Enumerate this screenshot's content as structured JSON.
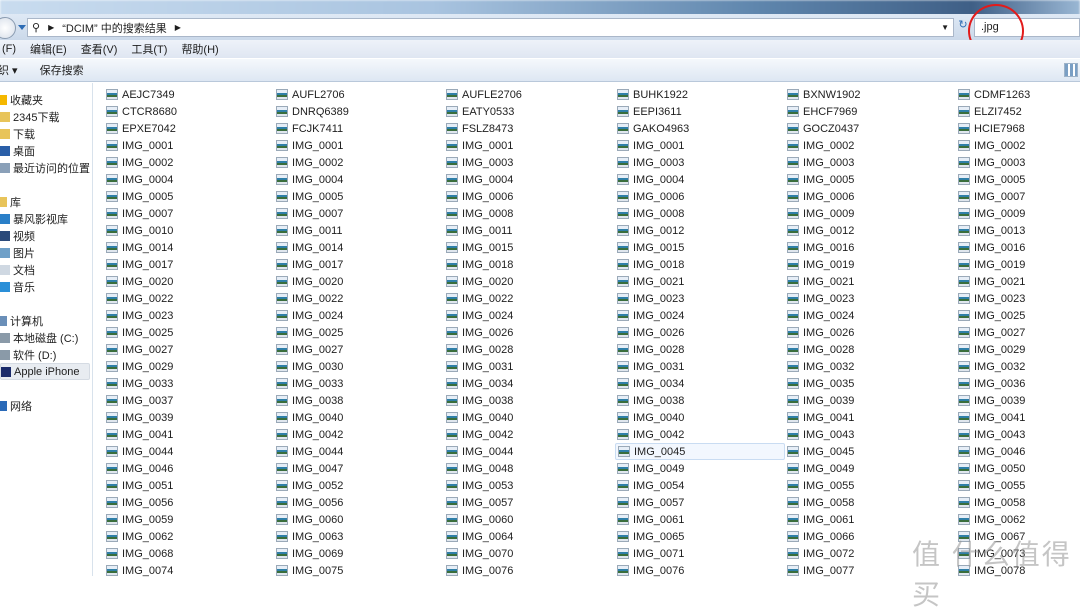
{
  "address": {
    "path": "“DCIM” 中的搜索结果",
    "search_value": ".jpg"
  },
  "menu": [
    "(F)",
    "编辑(E)",
    "查看(V)",
    "工具(T)",
    "帮助(H)"
  ],
  "toolbar": {
    "organize": "织 ▾",
    "save_search": "保存搜索"
  },
  "sidebar": {
    "items": [
      {
        "label": "收藏夹",
        "icon": "star-icon",
        "group": true
      },
      {
        "label": "2345下载",
        "icon": "folder-icon"
      },
      {
        "label": "下载",
        "icon": "download-folder-icon"
      },
      {
        "label": "桌面",
        "icon": "desktop-icon"
      },
      {
        "label": "最近访问的位置",
        "icon": "recent-places-icon"
      },
      {
        "label": "库",
        "icon": "library-icon",
        "group": true
      },
      {
        "label": "暴风影视库",
        "icon": "video-library-icon"
      },
      {
        "label": "视频",
        "icon": "video-icon"
      },
      {
        "label": "图片",
        "icon": "picture-icon"
      },
      {
        "label": "文档",
        "icon": "document-icon"
      },
      {
        "label": "音乐",
        "icon": "music-icon"
      },
      {
        "label": "计算机",
        "icon": "computer-icon",
        "group": true
      },
      {
        "label": "本地磁盘 (C:)",
        "icon": "drive-icon"
      },
      {
        "label": "软件 (D:)",
        "icon": "drive-icon"
      },
      {
        "label": "Apple iPhone",
        "icon": "iphone-icon",
        "selected": true
      },
      {
        "label": "网络",
        "icon": "network-icon",
        "group": true
      }
    ]
  },
  "files": {
    "selected": "IMG_0045",
    "columns": [
      [
        "AEJC7349",
        "CTCR8680",
        "EPXE7042",
        "IMG_0001",
        "IMG_0002",
        "IMG_0004",
        "IMG_0005",
        "IMG_0007",
        "IMG_0010",
        "IMG_0014",
        "IMG_0017",
        "IMG_0020",
        "IMG_0022",
        "IMG_0023",
        "IMG_0025",
        "IMG_0027",
        "IMG_0029",
        "IMG_0033",
        "IMG_0037",
        "IMG_0039",
        "IMG_0041",
        "IMG_0044",
        "IMG_0046",
        "IMG_0051",
        "IMG_0056",
        "IMG_0059",
        "IMG_0062",
        "IMG_0068",
        "IMG_0074"
      ],
      [
        "AUFL2706",
        "DNRQ6389",
        "FCJK7411",
        "IMG_0001",
        "IMG_0002",
        "IMG_0004",
        "IMG_0005",
        "IMG_0007",
        "IMG_0011",
        "IMG_0014",
        "IMG_0017",
        "IMG_0020",
        "IMG_0022",
        "IMG_0024",
        "IMG_0025",
        "IMG_0027",
        "IMG_0030",
        "IMG_0033",
        "IMG_0038",
        "IMG_0040",
        "IMG_0042",
        "IMG_0044",
        "IMG_0047",
        "IMG_0052",
        "IMG_0056",
        "IMG_0060",
        "IMG_0063",
        "IMG_0069",
        "IMG_0075"
      ],
      [
        "AUFLE2706",
        "EATY0533",
        "FSLZ8473",
        "IMG_0001",
        "IMG_0003",
        "IMG_0004",
        "IMG_0006",
        "IMG_0008",
        "IMG_0011",
        "IMG_0015",
        "IMG_0018",
        "IMG_0020",
        "IMG_0022",
        "IMG_0024",
        "IMG_0026",
        "IMG_0028",
        "IMG_0031",
        "IMG_0034",
        "IMG_0038",
        "IMG_0040",
        "IMG_0042",
        "IMG_0044",
        "IMG_0048",
        "IMG_0053",
        "IMG_0057",
        "IMG_0060",
        "IMG_0064",
        "IMG_0070",
        "IMG_0076"
      ],
      [
        "BUHK1922",
        "EEPI3611",
        "GAKO4963",
        "IMG_0001",
        "IMG_0003",
        "IMG_0004",
        "IMG_0006",
        "IMG_0008",
        "IMG_0012",
        "IMG_0015",
        "IMG_0018",
        "IMG_0021",
        "IMG_0023",
        "IMG_0024",
        "IMG_0026",
        "IMG_0028",
        "IMG_0031",
        "IMG_0034",
        "IMG_0038",
        "IMG_0040",
        "IMG_0042",
        "IMG_0045",
        "IMG_0049",
        "IMG_0054",
        "IMG_0057",
        "IMG_0061",
        "IMG_0065",
        "IMG_0071",
        "IMG_0076"
      ],
      [
        "BXNW1902",
        "EHCF7969",
        "GOCZ0437",
        "IMG_0002",
        "IMG_0003",
        "IMG_0005",
        "IMG_0006",
        "IMG_0009",
        "IMG_0012",
        "IMG_0016",
        "IMG_0019",
        "IMG_0021",
        "IMG_0023",
        "IMG_0024",
        "IMG_0026",
        "IMG_0028",
        "IMG_0032",
        "IMG_0035",
        "IMG_0039",
        "IMG_0041",
        "IMG_0043",
        "IMG_0045",
        "IMG_0049",
        "IMG_0055",
        "IMG_0058",
        "IMG_0061",
        "IMG_0066",
        "IMG_0072",
        "IMG_0077"
      ],
      [
        "CDMF1263",
        "ELZI7452",
        "HCIE7968",
        "IMG_0002",
        "IMG_0003",
        "IMG_0005",
        "IMG_0007",
        "IMG_0009",
        "IMG_0013",
        "IMG_0016",
        "IMG_0019",
        "IMG_0021",
        "IMG_0023",
        "IMG_0025",
        "IMG_0027",
        "IMG_0029",
        "IMG_0032",
        "IMG_0036",
        "IMG_0039",
        "IMG_0041",
        "IMG_0043",
        "IMG_0046",
        "IMG_0050",
        "IMG_0055",
        "IMG_0058",
        "IMG_0062",
        "IMG_0067",
        "IMG_0073",
        "IMG_0078"
      ]
    ]
  },
  "watermark": "值 什么值得买",
  "colors": {
    "annotation_circle": "#e21b1b",
    "selection": "#c9dcf2"
  }
}
